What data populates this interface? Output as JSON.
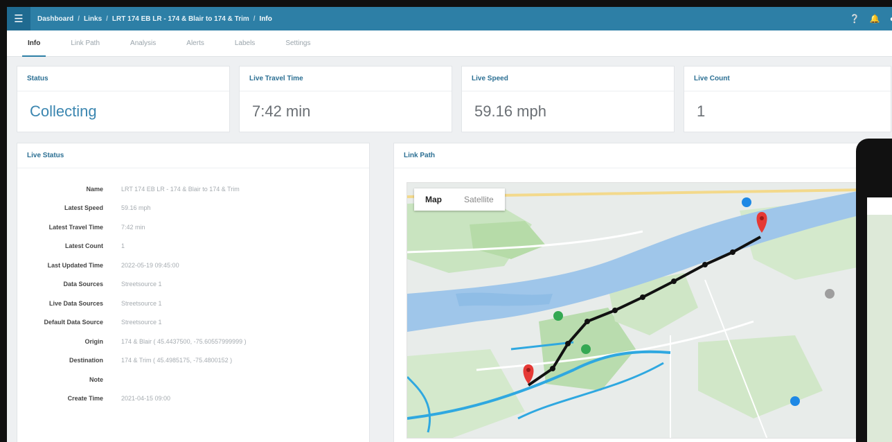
{
  "breadcrumbs": [
    "Dashboard",
    "Links",
    "LRT 174 EB LR - 174 & Blair to 174 & Trim",
    "174 & Blair to 174 & Trim",
    "Info"
  ],
  "tabs": [
    {
      "label": "Info",
      "active": true
    },
    {
      "label": "Link Path",
      "active": false
    },
    {
      "label": "Analysis",
      "active": false
    },
    {
      "label": "Alerts",
      "active": false
    },
    {
      "label": "Labels",
      "active": false
    },
    {
      "label": "Settings",
      "active": false
    }
  ],
  "stats": [
    {
      "title": "Status",
      "value": "Collecting"
    },
    {
      "title": "Live Travel Time",
      "value": "7:42 min"
    },
    {
      "title": "Live Speed",
      "value": "59.16 mph"
    },
    {
      "title": "Live Count",
      "value": "1"
    }
  ],
  "live_status": {
    "title": "Live Status",
    "rows": [
      {
        "key": "Name",
        "value": "LRT 174 EB LR - 174 & Blair to 174 & Trim"
      },
      {
        "key": "Latest Speed",
        "value": "59.16 mph"
      },
      {
        "key": "Latest Travel Time",
        "value": "7:42 min"
      },
      {
        "key": "Latest Count",
        "value": "1"
      },
      {
        "key": "Last Updated Time",
        "value": "2022-05-19 09:45:00"
      },
      {
        "key": "Data Sources",
        "value": "Streetsource 1"
      },
      {
        "key": "Live Data Sources",
        "value": "Streetsource 1"
      },
      {
        "key": "Default Data Source",
        "value": "Streetsource 1"
      },
      {
        "key": "Origin",
        "value": "174 & Blair ( 45.4437500, -75.60557999999 )"
      },
      {
        "key": "Destination",
        "value": "174 & Trim ( 45.4985175, -75.4800152 )"
      },
      {
        "key": "Note",
        "value": ""
      },
      {
        "key": "Create Time",
        "value": "2021-04-15 09:00"
      }
    ]
  },
  "link_path": {
    "title": "Link Path",
    "map_button": "Map",
    "satellite_button": "Satellite"
  },
  "colors": {
    "topbar": "#2d7fa6",
    "accent": "#2b6f93",
    "route": "#111111",
    "marker": "#e53935"
  },
  "icons": [
    "menu-icon",
    "help-icon",
    "bell-icon",
    "user-icon",
    "map-marker-icon"
  ]
}
